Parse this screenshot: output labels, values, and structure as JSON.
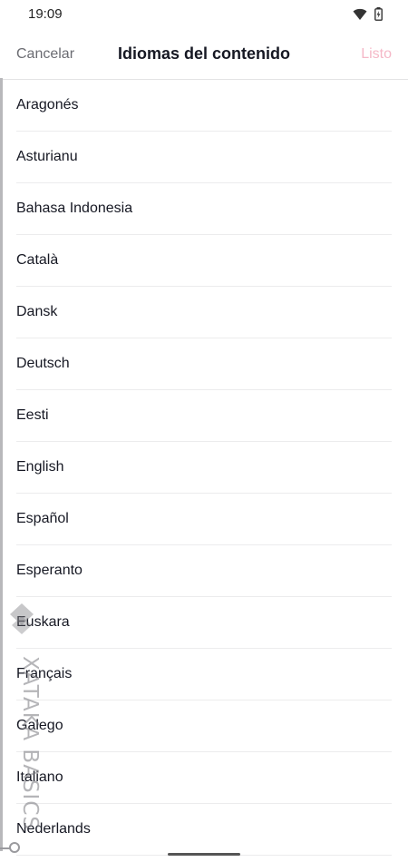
{
  "status_bar": {
    "time": "19:09"
  },
  "header": {
    "cancel_label": "Cancelar",
    "title": "Idiomas del contenido",
    "done_label": "Listo"
  },
  "languages": [
    "Aragonés",
    "Asturianu",
    "Bahasa Indonesia",
    "Català",
    "Dansk",
    "Deutsch",
    "Eesti",
    "English",
    "Español",
    "Esperanto",
    "Euskara",
    "Français",
    "Galego",
    "Italiano",
    "Nederlands"
  ],
  "watermark": {
    "text": "XATAKA BASICS"
  },
  "colors": {
    "done_disabled": "#f5b8c7",
    "text_primary": "#161823",
    "text_secondary": "#6b6c72"
  }
}
